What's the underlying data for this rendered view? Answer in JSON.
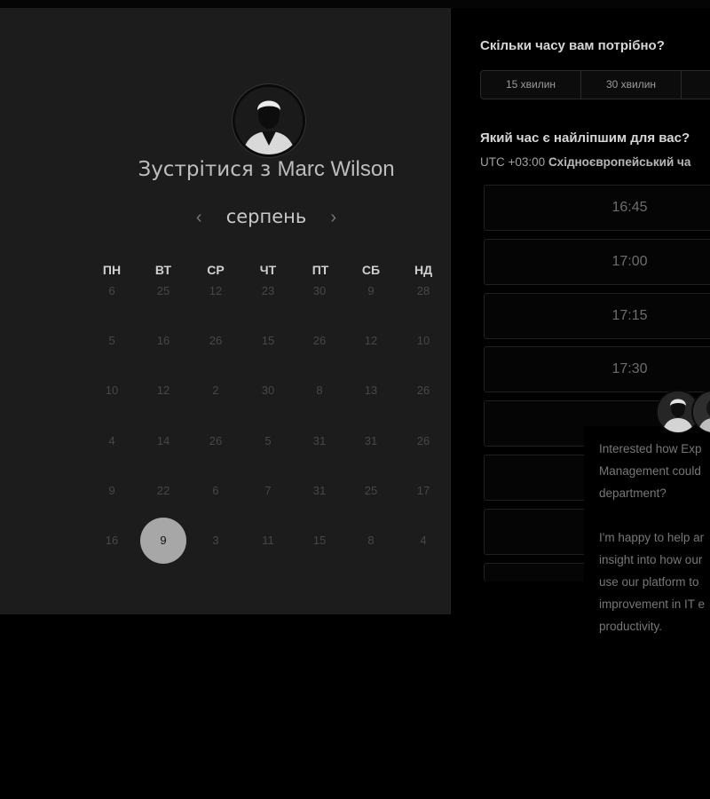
{
  "meeting": {
    "prefix": "Зустрітися з",
    "host": "Marc Wilson",
    "month": "серпень",
    "prev_icon": "chevron-left-icon",
    "next_icon": "chevron-right-icon"
  },
  "calendar": {
    "weekdays": [
      "ПН",
      "ВТ",
      "СР",
      "ЧТ",
      "ПТ",
      "СБ",
      "НД"
    ],
    "rows": [
      [
        "6",
        "25",
        "12",
        "23",
        "30",
        "9",
        "28"
      ],
      [
        "5",
        "16",
        "26",
        "15",
        "26",
        "12",
        "10"
      ],
      [
        "10",
        "12",
        "2",
        "30",
        "8",
        "13",
        "26"
      ],
      [
        "4",
        "14",
        "26",
        "5",
        "31",
        "31",
        "26"
      ],
      [
        "9",
        "22",
        "6",
        "7",
        "31",
        "25",
        "17"
      ],
      [
        "16",
        "9",
        "3",
        "11",
        "15",
        "8",
        "4"
      ]
    ],
    "selected_day": "9"
  },
  "duration": {
    "title": "Скільки часу вам потрібно?",
    "options": [
      "15 хвилин",
      "30 хвилин",
      ""
    ]
  },
  "slots": {
    "title": "Який час є найліпшим для вас?",
    "tz_prefix": "UTC +03:00",
    "tz_name": "Східноєвропейський ча",
    "times": [
      "16:45",
      "17:00",
      "17:15",
      "17:30"
    ]
  },
  "chat": {
    "lines": [
      "Interested how Exp",
      "Management could",
      "department?",
      "I'm happy to help ar",
      "insight into how our",
      "use our platform to",
      "improvement in IT e",
      "productivity."
    ]
  },
  "colors": {
    "panel": "#1c1c1c",
    "selected_day": "#a7a7a7"
  }
}
